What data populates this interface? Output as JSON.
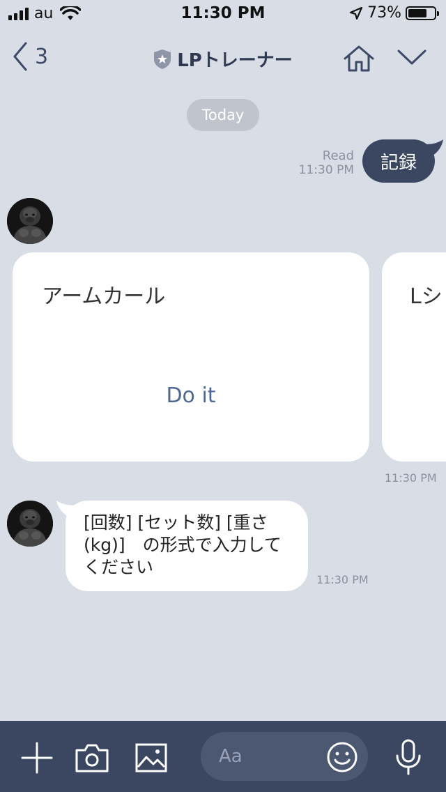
{
  "status_bar": {
    "carrier": "au",
    "time": "11:30 PM",
    "battery": "73%",
    "battery_level": 0.73
  },
  "nav": {
    "back_count": "3",
    "title": "LPトレーナー"
  },
  "chat": {
    "date_label": "Today",
    "sent": {
      "read_label": "Read",
      "time": "11:30 PM",
      "text": "記録"
    },
    "cards": [
      {
        "title": "アームカール",
        "action": "Do it"
      },
      {
        "title": "Lシ"
      }
    ],
    "cards_time": "11:30 PM",
    "received": {
      "line1": "[回数] [セット数] [重さ",
      "line2": "(kg)]　の形式で入力して",
      "line3": "ください",
      "time": "11:30 PM"
    }
  },
  "input": {
    "placeholder": "Aa"
  },
  "colors": {
    "background": "#d9dde6",
    "accent_dark": "#3b4661",
    "link_blue": "#4e6891"
  }
}
